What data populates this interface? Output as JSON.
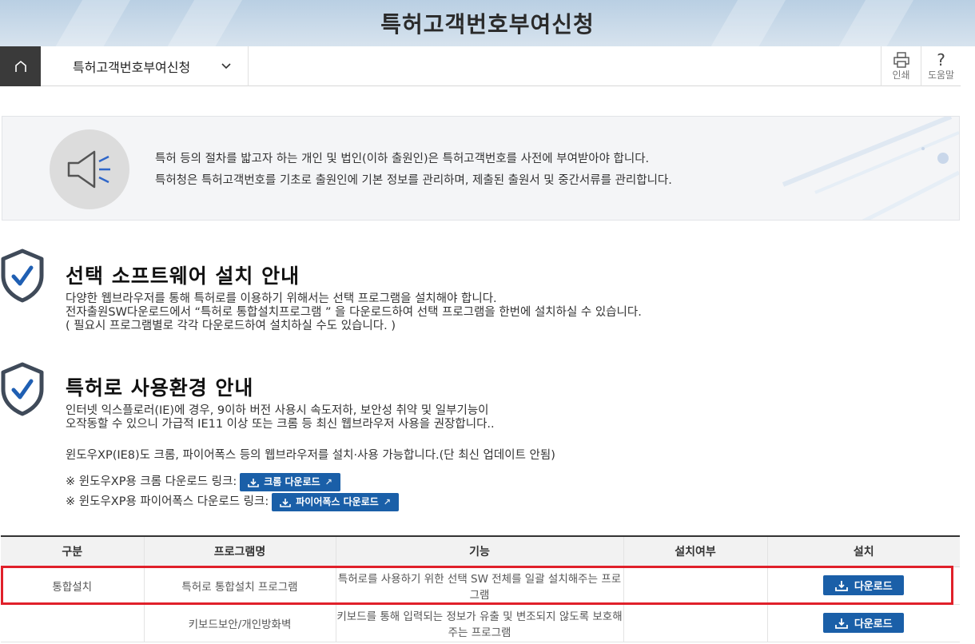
{
  "page": {
    "title": "특허고객번호부여신청"
  },
  "navbar": {
    "breadcrumb": "특허고객번호부여신청",
    "print_label": "인쇄",
    "help_label": "도움말",
    "icons": {
      "home": "home-icon",
      "dropdown": "chevron-down-icon",
      "print": "printer-icon",
      "help": "question-icon"
    }
  },
  "notice": {
    "line1": "특허 등의 절차를 밟고자 하는 개인 및 법인(이하 출원인)은 특허고객번호를 사전에 부여받아야 합니다.",
    "line2": "특허청은 특허고객번호를 기초로 출원인에 기본 정보를 관리하며, 제출된 출원서 및 중간서류를 관리합니다.",
    "icon": "megaphone-icon"
  },
  "software": {
    "title": "선택 소프트웨어 설치 안내",
    "line1": "다양한 웹브라우저를 통해 특허로를 이용하기 위해서는 선택 프로그램을 설치해야 합니다.",
    "line2": "전자출원SW다운로드에서 “특허로 통합설치프로그램 ” 을 다운로드하여 선택 프로그램을 한번에 설치하실 수 있습니다.",
    "line3": "( 필요시 프로그램별로 각각 다운로드하여 설치하실 수도 있습니다. )"
  },
  "environment": {
    "title": "특허로 사용환경 안내",
    "line1": "인터넷 익스플로러(IE)에 경우, 9이하 버전 사용시 속도저하, 보안성 취약 및 일부기능이",
    "line2": "오작동할 수 있으니 가급적 IE11 이상 또는 크롬 등 최신 웹브라우저 사용을 권장합니다..",
    "line3": "윈도우XP(IE8)도 크롬, 파이어폭스 등의 웹브라우저를 설치·사용 가능합니다.(단 최신 업데이트 안됨)",
    "chrome_label": "※ 윈도우XP용 크롬 다운로드 링크:",
    "chrome_button": "크롬 다운로드",
    "firefox_label": "※ 윈도우XP용 파이어폭스 다운로드 링크:",
    "firefox_button": "파이어폭스 다운로드"
  },
  "table": {
    "headers": [
      "구분",
      "프로그램명",
      "기능",
      "설치여부",
      "설치"
    ],
    "rows": [
      {
        "category": "통합설치",
        "program": "특허로 통합설치 프로그램",
        "function": "특허로를 사용하기 위한 선택 SW 전체를 일괄 설치해주는 프로그램",
        "installed": "",
        "button": "다운로드"
      },
      {
        "category": "",
        "program": "키보드보안/개인방화벽",
        "function": "키보드를 통해 입력되는 정보가 유출 및 변조되지 않도록 보호해주는 프로그램",
        "installed": "",
        "button": "다운로드"
      }
    ]
  },
  "colors": {
    "accent": "#1a5fa8",
    "highlight": "#e0202a",
    "header_dark": "#3a3a3a"
  }
}
